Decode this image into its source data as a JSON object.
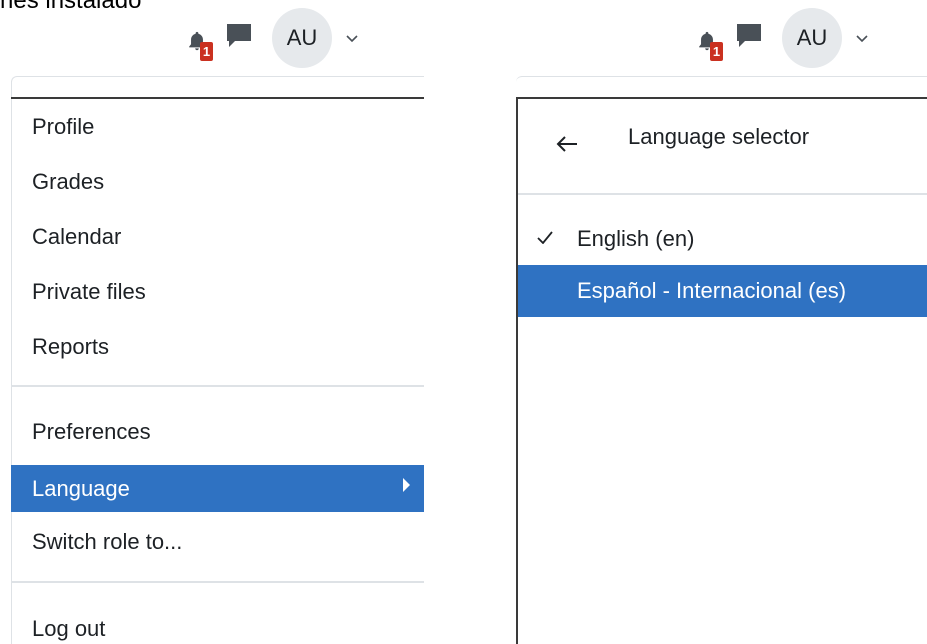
{
  "caption": "nes instalado",
  "navbar": {
    "notification_count": "1",
    "avatar_initials": "AU"
  },
  "user_menu": {
    "items": [
      {
        "label": "Profile"
      },
      {
        "label": "Grades"
      },
      {
        "label": "Calendar"
      },
      {
        "label": "Private files"
      },
      {
        "label": "Reports"
      },
      {
        "label": "Preferences"
      },
      {
        "label": "Language",
        "active": true
      },
      {
        "label": "Switch role to..."
      },
      {
        "label": "Log out"
      }
    ]
  },
  "language_panel": {
    "title": "Language selector",
    "options": [
      {
        "label": "English (en)",
        "checked": true
      },
      {
        "label": "Español - Internacional (es)",
        "highlighted": true
      }
    ]
  },
  "colors": {
    "accent": "#2f72c2",
    "badge": "#ca3120",
    "avatar_bg": "#e6e9ec"
  }
}
